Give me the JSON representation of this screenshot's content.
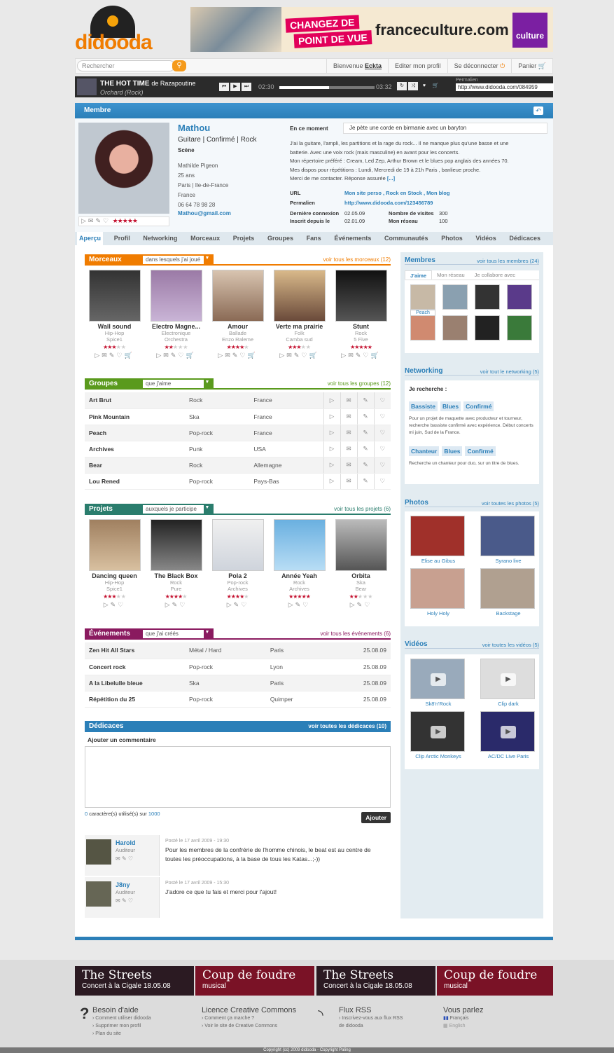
{
  "header": {
    "logo_text": "didooda",
    "banner": {
      "line1": "CHANGEZ DE",
      "line2": "POINT DE VUE",
      "domain": "franceculture.com",
      "brand": "culture"
    },
    "search_placeholder": "Rechercher",
    "welcome": "Bienvenue",
    "user": "Eckta",
    "links": [
      "Editer mon profil",
      "Se déconnecter",
      "Panier"
    ]
  },
  "player": {
    "title": "THE HOT TIME",
    "by": "de Razapoutine",
    "album": "Orchard",
    "genre": "(Rock)",
    "elapsed": "02:30",
    "total": "03:32",
    "progress": 0.52,
    "permalink_label": "Permalien",
    "permalink": "http://www.didooda.com/084959"
  },
  "card_title": "Membre",
  "profile": {
    "name": "Mathou",
    "instruments": "Guitare | Confirmé | Rock",
    "scene": "Scène",
    "fullname": "Mathilde Pigeon",
    "age": "25 ans",
    "city": "Paris | Ile-de-France",
    "country": "France",
    "phone": "06 64 78 98 28",
    "email": "Mathou@gmail.com",
    "moment_label": "En ce moment",
    "moment": "Je pète une corde en birmanie avec un baryton",
    "bio": [
      "J'ai la guitare, l'ampli, les  partitions et la rage du rock... Il ne manque plus qu'une basse et une",
      "batterie. Avec une voix rock (mais masculine) en avant pour les concerts.",
      "Mon répertoire préféré : Cream, Led Zep, Arthur Brown et le blues pop anglais des années 70.",
      "Mes dispos pour répétitions : Lundi, Mercredi de 19 à 21h Paris , banlieue proche.",
      "Merci de me contacter. Réponse assurée"
    ],
    "bio_more": "[...]",
    "url_label": "URL",
    "url_links": "Mon site perso , Rock en Stock , Mon blog",
    "perma_label": "Permalien",
    "perma": "http://www.didooda.com/123456789",
    "last_login_label": "Dernière connexion",
    "last_login": "02.05.09",
    "since_label": "Inscrit depuis le",
    "since": "02.01.09",
    "visits_label": "Nombre de visites",
    "visits": "300",
    "network_label": "Mon réseau",
    "network": "100"
  },
  "tabs": [
    "Aperçu",
    "Profil",
    "Networking",
    "Morceaux",
    "Projets",
    "Groupes",
    "Fans",
    "Événements",
    "Communautés",
    "Photos",
    "Vidéos",
    "Dédicaces"
  ],
  "morceaux": {
    "title": "Morceaux",
    "filter": "dans lesquels j'ai joué",
    "more": "voir tous les morceaux (12)",
    "items": [
      {
        "title": "Wall sound",
        "genre": "Hip-Hop",
        "who": "Spice1",
        "stars": 3
      },
      {
        "title": "Electro Magne...",
        "genre": "Electronique",
        "who": "Orchestra",
        "stars": 2
      },
      {
        "title": "Amour",
        "genre": "Ballade",
        "who": "Enzo Raleme",
        "stars": 4
      },
      {
        "title": "Verte ma prairie",
        "genre": "Folk",
        "who": "Camba sud",
        "stars": 3
      },
      {
        "title": "Stunt",
        "genre": "Rock",
        "who": "5 Five",
        "stars": 5
      }
    ]
  },
  "groupes": {
    "title": "Groupes",
    "filter": "que j'aime",
    "more": "voir tous les groupes (12)",
    "rows": [
      [
        "Art Brut",
        "Rock",
        "France"
      ],
      [
        "Pink Mountain",
        "Ska",
        "France"
      ],
      [
        "Peach",
        "Pop-rock",
        "France"
      ],
      [
        "Archives",
        "Punk",
        "USA"
      ],
      [
        "Bear",
        "Rock",
        "Allemagne"
      ],
      [
        "Lou Rened",
        "Pop-rock",
        "Pays-Bas"
      ]
    ]
  },
  "projets": {
    "title": "Projets",
    "filter": "auxquels je participe",
    "more": "voir tous les projets (6)",
    "items": [
      {
        "title": "Dancing queen",
        "genre": "Hip-Hop",
        "who": "Spice1",
        "stars": 3
      },
      {
        "title": "The Black Box",
        "genre": "Rock",
        "who": "Pure",
        "stars": 4
      },
      {
        "title": "Pola 2",
        "genre": "Pop-rock",
        "who": "Archives",
        "stars": 4
      },
      {
        "title": "Année Yeah",
        "genre": "Rock",
        "who": "Archives",
        "stars": 5
      },
      {
        "title": "Orbita",
        "genre": "Ska",
        "who": "Bear",
        "stars": 2
      }
    ]
  },
  "evenements": {
    "title": "Événements",
    "filter": "que j'ai créés",
    "more": "voir tous les événements (6)",
    "rows": [
      [
        "Zen Hit All Stars",
        "Métal / Hard",
        "Paris",
        "25.08.09"
      ],
      [
        "Concert rock",
        "Pop-rock",
        "Lyon",
        "25.08.09"
      ],
      [
        "A la Libelulle bleue",
        "Ska",
        "Paris",
        "25.08.09"
      ],
      [
        "Répétition du 25",
        "Pop-rock",
        "Quimper",
        "25.08.09"
      ]
    ]
  },
  "dedicaces": {
    "title": "Dédicaces",
    "more": "voir toutes les dédicaces (10)",
    "add_label": "Ajouter un commentaire",
    "count_pre": "0",
    "count_mid": "caractère(s) utilisé(s) sur",
    "count_max": "1000",
    "submit": "Ajouter",
    "comments": [
      {
        "name": "Harold",
        "role": "Auditeur",
        "date": "Posté le 17 avril 2009 - 19:30",
        "text": "Pour les membres de la confrérie de l'homme chinois, le beat est au centre de toutes les préoccupations, à la base de tous les Katas...;-))"
      },
      {
        "name": "J8ny",
        "role": "Auditeur",
        "date": "Posté le 17 avril 2009 - 15:30",
        "text": "J'adore ce que tu fais et merci pour l'ajout!"
      }
    ]
  },
  "side": {
    "membres": {
      "title": "Membres",
      "more": "voir tous les membres (24)",
      "tabs": [
        "J'aime",
        "Mon réseau",
        "Je collabore avec"
      ],
      "first_label": "Peach"
    },
    "networking": {
      "title": "Networking",
      "more": "voir tout le networking (5)",
      "search": "Je recherche :",
      "tags1": [
        "Bassiste",
        "Blues",
        "Confirmé"
      ],
      "text1": "Pour un projet de maquette avec producteur et tourneur, recherche bassiste confirmé avec expérience. Début concerts mi juin, Sud de la France.",
      "tags2": [
        "Chanteur",
        "Blues",
        "Confirmé"
      ],
      "text2": "Recherche un chanteur pour duo, sur un titre de blues."
    },
    "photos": {
      "title": "Photos",
      "more": "voir toutes les photos (5)",
      "items": [
        "Elise au Gibus",
        "Syrano live",
        "Holy Holy",
        "Backstage"
      ]
    },
    "videos": {
      "title": "Vidéos",
      "more": "voir toutes les vidéos (5)",
      "items": [
        "Sk8'n'Rock",
        "Clip dark",
        "Clip Arctic Monkeys",
        "AC/DC Live Paris"
      ]
    }
  },
  "footer": {
    "banners": [
      {
        "big": "The Streets",
        "small": "Concert à la Cigale 18.05.08"
      },
      {
        "big": "Coup de foudre",
        "small": "musical"
      },
      {
        "big": "The Streets",
        "small": "Concert à la Cigale 18.05.08"
      },
      {
        "big": "Coup de foudre",
        "small": "musical"
      }
    ],
    "help": {
      "title": "Besoin d'aide",
      "links": [
        "› Comment utiliser didooda",
        "› Supprimer mon profil",
        "› Plan du site"
      ]
    },
    "licence": {
      "title": "Licence Creative Commons",
      "links": [
        "› Comment ça marche ?",
        "› Voir le site de Creative Commons"
      ]
    },
    "rss": {
      "title": "Flux RSS",
      "links": [
        "› Inscrivez-vous aux flux RSS",
        "de didooda"
      ]
    },
    "lang": {
      "title": "Vous parlez",
      "links": [
        "Français",
        "English"
      ]
    },
    "copyright": "Copyright (cc) 2009 didooda  -  Copyright Paling"
  },
  "colors": {
    "brand": "#f07c00",
    "blue": "#2b7fb8",
    "green": "#5a9a1d",
    "teal": "#2a7d6d",
    "purple": "#8a1a5f",
    "star": "#c41230"
  }
}
